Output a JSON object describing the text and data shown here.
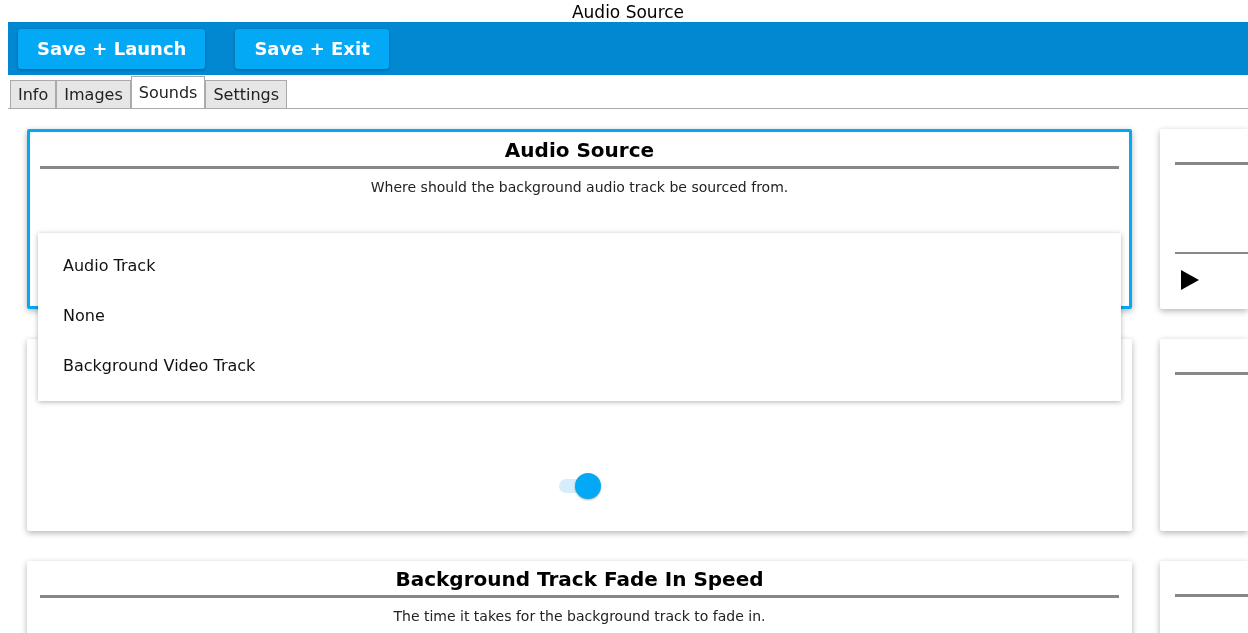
{
  "window": {
    "title": "Audio Source"
  },
  "toolbar": {
    "buttons": [
      "Save + Launch",
      "Save + Exit"
    ]
  },
  "tabs": [
    {
      "label": "Info",
      "selected": false
    },
    {
      "label": "Images",
      "selected": false
    },
    {
      "label": "Sounds",
      "selected": true
    },
    {
      "label": "Settings",
      "selected": false
    }
  ],
  "settings": [
    {
      "kind": "dropdown",
      "title": "Audio Source",
      "description": "Where should the background audio track be sourced from.",
      "focused": true,
      "options": [
        "Audio Track",
        "None",
        "Background Video Track"
      ]
    },
    {
      "kind": "toggle",
      "on": true,
      "focused": false
    },
    {
      "kind": "plain",
      "title": "Background Track Fade In Speed",
      "description": "The time it takes for the background track to fade in.",
      "focused": false
    }
  ],
  "side_cards": [
    {
      "kind": "player"
    },
    {
      "kind": "blank"
    },
    {
      "kind": "blank"
    }
  ]
}
